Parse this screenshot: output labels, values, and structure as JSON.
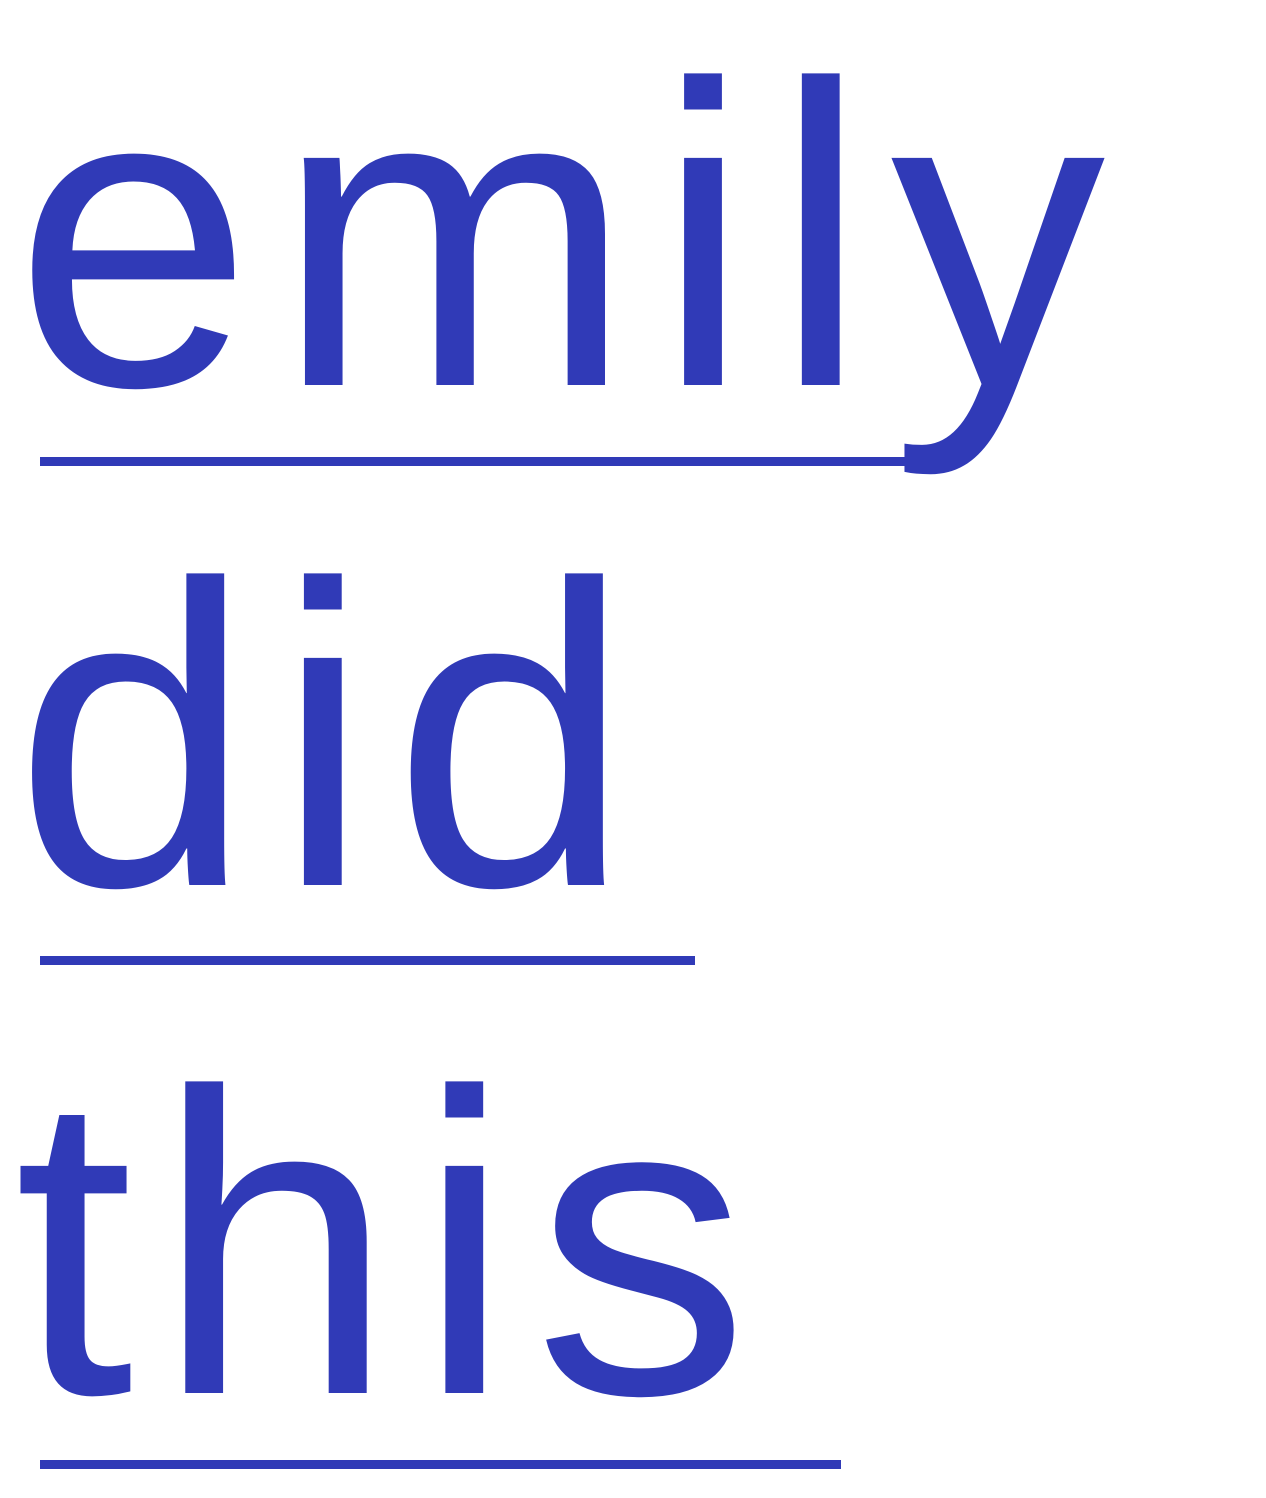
{
  "brand_color": "#303AB7",
  "logo": {
    "lines": [
      "emily",
      "did",
      "this"
    ]
  }
}
